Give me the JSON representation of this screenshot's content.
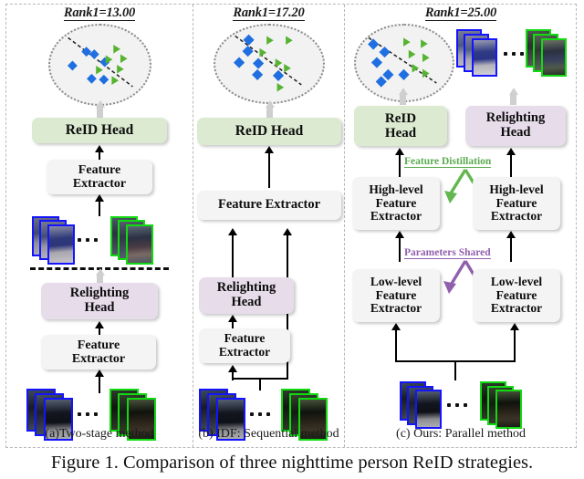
{
  "figure": {
    "caption": "Figure 1.  Comparison of three nighttime person ReID strategies."
  },
  "panels": [
    {
      "id": "a",
      "rank_label": "Rank1=13.00",
      "caption": "(a)Two-stage method",
      "nodes": [
        {
          "name": "reid-head",
          "label": "ReID Head",
          "style": "green"
        },
        {
          "name": "feature-extractor-top",
          "label": "Feature\nExtractor",
          "style": "grey"
        },
        {
          "name": "relighting-head",
          "label": "Relighting\nHead",
          "style": "purple"
        },
        {
          "name": "feature-extractor-bottom",
          "label": "Feature\nExtractor",
          "style": "grey"
        }
      ]
    },
    {
      "id": "b",
      "rank_label": "Rank1=17.20",
      "caption": "(b) IDF: Sequential method",
      "nodes": [
        {
          "name": "reid-head",
          "label": "ReID Head",
          "style": "green"
        },
        {
          "name": "feature-extractor-shared",
          "label": "Feature  Extractor",
          "style": "grey"
        },
        {
          "name": "relighting-head",
          "label": "Relighting\nHead",
          "style": "purple"
        },
        {
          "name": "feature-extractor-bottom",
          "label": "Feature\nExtractor",
          "style": "grey"
        }
      ]
    },
    {
      "id": "c",
      "rank_label": "Rank1=25.00",
      "caption": "(c) Ours: Parallel method",
      "nodes": [
        {
          "name": "reid-head",
          "label": "ReID\nHead",
          "style": "green"
        },
        {
          "name": "relighting-head",
          "label": "Relighting\nHead",
          "style": "purple"
        },
        {
          "name": "high-level-feature-extractor-left",
          "label": "High-level\nFeature\nExtractor",
          "style": "grey"
        },
        {
          "name": "high-level-feature-extractor-right",
          "label": "High-level\nFeature\nExtractor",
          "style": "grey"
        },
        {
          "name": "low-level-feature-extractor-left",
          "label": "Low-level\nFeature\nExtractor",
          "style": "grey"
        },
        {
          "name": "low-level-feature-extractor-right",
          "label": "Low-level\nFeature\nExtractor",
          "style": "grey"
        }
      ],
      "annotations": [
        {
          "name": "feature-distillation-label",
          "label": "Feature Distillation",
          "color": "#5aab4f"
        },
        {
          "name": "parameters-shared-label",
          "label": "Parameters Shared",
          "color": "#9160ad"
        }
      ]
    }
  ],
  "colors": {
    "reid_head_fill": "#dbead0",
    "relighting_head_fill": "#e6dcea",
    "extractor_fill": "#f4f4f4",
    "query_border": "#1414ff",
    "gallery_border": "#12d912",
    "distillation": "#5aab4f",
    "parameters_shared": "#9160ad",
    "scatter_query_marker": "#1f6fe0",
    "scatter_gallery_marker": "#56b332"
  },
  "chart_data": [
    {
      "type": "scatter",
      "title": "Rank1=13.00",
      "panel": "a",
      "xlim": [
        0,
        100
      ],
      "ylim": [
        0,
        100
      ],
      "grid": false,
      "legend": null,
      "series": [
        {
          "name": "ID-A (blue diamond)",
          "marker": "diamond",
          "color": "#1f6fe0",
          "points": [
            [
              22,
              50
            ],
            [
              37,
              68
            ],
            [
              44,
              64
            ],
            [
              54,
              55
            ],
            [
              41,
              36
            ],
            [
              52,
              35
            ],
            [
              56,
              46
            ]
          ]
        },
        {
          "name": "ID-B (green triangle)",
          "marker": "triangle",
          "color": "#56b332",
          "points": [
            [
              70,
              74
            ],
            [
              77,
              63
            ],
            [
              48,
              46
            ],
            [
              72,
              49
            ],
            [
              64,
              36
            ],
            [
              60,
              66
            ]
          ]
        }
      ],
      "boundary_line": {
        "from": [
          20,
          82
        ],
        "to": [
          84,
          22
        ],
        "style": "dashed"
      }
    },
    {
      "type": "scatter",
      "title": "Rank1=17.20",
      "panel": "b",
      "xlim": [
        0,
        100
      ],
      "ylim": [
        0,
        100
      ],
      "grid": false,
      "legend": null,
      "series": [
        {
          "name": "ID-A (blue diamond)",
          "marker": "diamond",
          "color": "#1f6fe0",
          "points": [
            [
              32,
              80
            ],
            [
              31,
              66
            ],
            [
              22,
              52
            ],
            [
              42,
              50
            ],
            [
              41,
              36
            ],
            [
              60,
              34
            ]
          ]
        },
        {
          "name": "ID-B (green triangle)",
          "marker": "triangle",
          "color": "#56b332",
          "points": [
            [
              52,
              80
            ],
            [
              70,
              80
            ],
            [
              46,
              62
            ],
            [
              60,
              50
            ],
            [
              68,
              46
            ],
            [
              62,
              20
            ]
          ]
        }
      ],
      "boundary_line": {
        "from": [
          22,
          86
        ],
        "to": [
          80,
          26
        ],
        "style": "dashed"
      }
    },
    {
      "type": "scatter",
      "title": "Rank1=25.00",
      "panel": "c",
      "xlim": [
        0,
        100
      ],
      "ylim": [
        0,
        100
      ],
      "grid": false,
      "legend": null,
      "series": [
        {
          "name": "ID-A (blue diamond)",
          "marker": "diamond",
          "color": "#1f6fe0",
          "points": [
            [
              18,
              76
            ],
            [
              30,
              66
            ],
            [
              22,
              52
            ],
            [
              36,
              36
            ],
            [
              28,
              28
            ],
            [
              48,
              34
            ]
          ]
        },
        {
          "name": "ID-B (green triangle)",
          "marker": "triangle",
          "color": "#56b332",
          "points": [
            [
              52,
              78
            ],
            [
              70,
              76
            ],
            [
              58,
              62
            ],
            [
              72,
              56
            ],
            [
              62,
              46
            ],
            [
              74,
              38
            ]
          ]
        }
      ],
      "boundary_line": {
        "from": [
          14,
          84
        ],
        "to": [
          82,
          24
        ],
        "style": "dashed"
      }
    }
  ]
}
